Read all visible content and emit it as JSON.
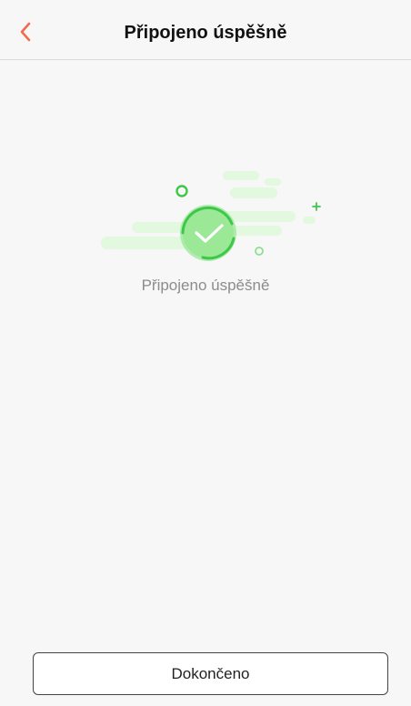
{
  "header": {
    "back_icon": "chevron-left-icon",
    "title": "Připojeno úspěšně"
  },
  "main": {
    "illustration_icon": "success-check-icon",
    "status_text": "Připojeno úspěšně"
  },
  "footer": {
    "done_label": "Dokončeno"
  },
  "colors": {
    "accent": "#f26b4b",
    "success": "#3ec84a",
    "success_light": "#dff7dc"
  }
}
